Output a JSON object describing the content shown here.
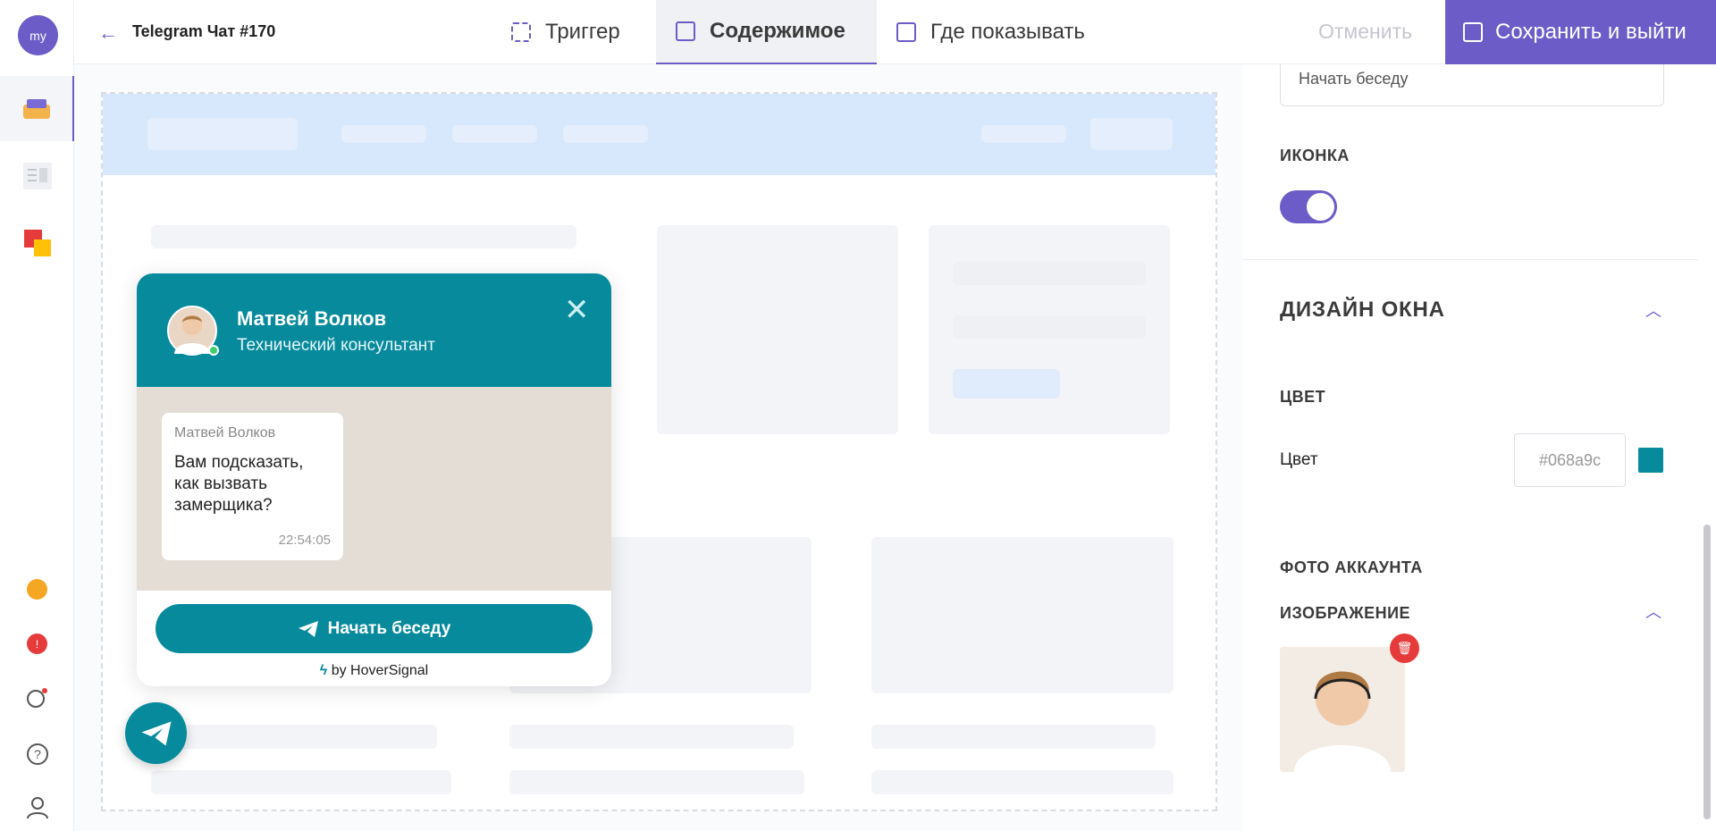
{
  "sidebar": {
    "logo": "my"
  },
  "topbar": {
    "title": "Telegram Чат #170",
    "tabs": [
      {
        "label": "Триггер"
      },
      {
        "label": "Содержимое"
      },
      {
        "label": "Где показывать"
      }
    ],
    "cancel_label": "Отменить",
    "save_label": "Сохранить и выйти"
  },
  "widget": {
    "name": "Матвей Волков",
    "role": "Технический консультант",
    "message_sender": "Матвей Волков",
    "message_text": "Вам подсказать, как вызвать замерщика?",
    "message_time": "22:54:05",
    "button_label": "Начать беседу",
    "brand": "by HoverSignal"
  },
  "panel": {
    "button_text_value": "Начать беседу",
    "icon_label": "ИКОНКА",
    "section_title": "ДИЗАЙН ОКНА",
    "color_heading": "ЦВЕТ",
    "color_label": "Цвет",
    "color_value": "#068a9c",
    "photo_heading": "ФОТО АККАУНТА",
    "image_heading": "ИЗОБРАЖЕНИЕ"
  },
  "colors": {
    "accent": "#6c5cc7",
    "widget": "#068a9c"
  }
}
